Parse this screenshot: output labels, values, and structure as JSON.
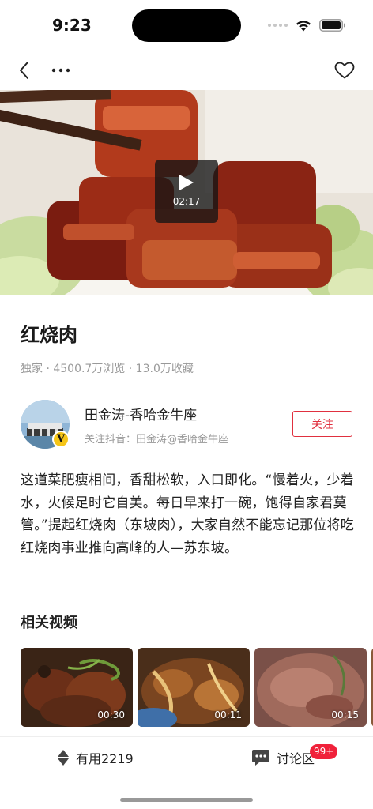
{
  "status_bar": {
    "time": "9:23",
    "icons": [
      "cellular-signal-icon",
      "wifi-icon",
      "battery-icon"
    ]
  },
  "nav": {
    "icons": [
      "back-icon",
      "more-icon",
      "heart-icon"
    ]
  },
  "video": {
    "duration": "02:17",
    "icon": "play-icon"
  },
  "recipe": {
    "title": "红烧肉",
    "stats": "独家 · 4500.7万浏览 · 13.0万收藏",
    "description": "这道菜肥瘦相间，香甜松软，入口即化。“慢着火，少着水，火候足时它自美。每日早来打一碗，饱得自家君莫管。”提起红烧肉（东坡肉），大家自然不能忘记那位将吃红烧肉事业推向高峰的人—苏东坡。"
  },
  "author": {
    "name": "田金涛-香哈金牛座",
    "subtitle": "关注抖音：田金涛@香哈金牛座",
    "badge": "V",
    "follow_label": "关注"
  },
  "related": {
    "title": "相关视频",
    "videos": [
      {
        "duration": "00:30"
      },
      {
        "duration": "00:11"
      },
      {
        "duration": "00:15"
      }
    ]
  },
  "bottom_bar": {
    "useful_label": "有用2219",
    "discuss_label": "讨论区",
    "comment_badge": "99+"
  },
  "colors": {
    "accent_red": "#e0303f",
    "badge_red": "#f0213a",
    "muted_text": "#999999"
  }
}
